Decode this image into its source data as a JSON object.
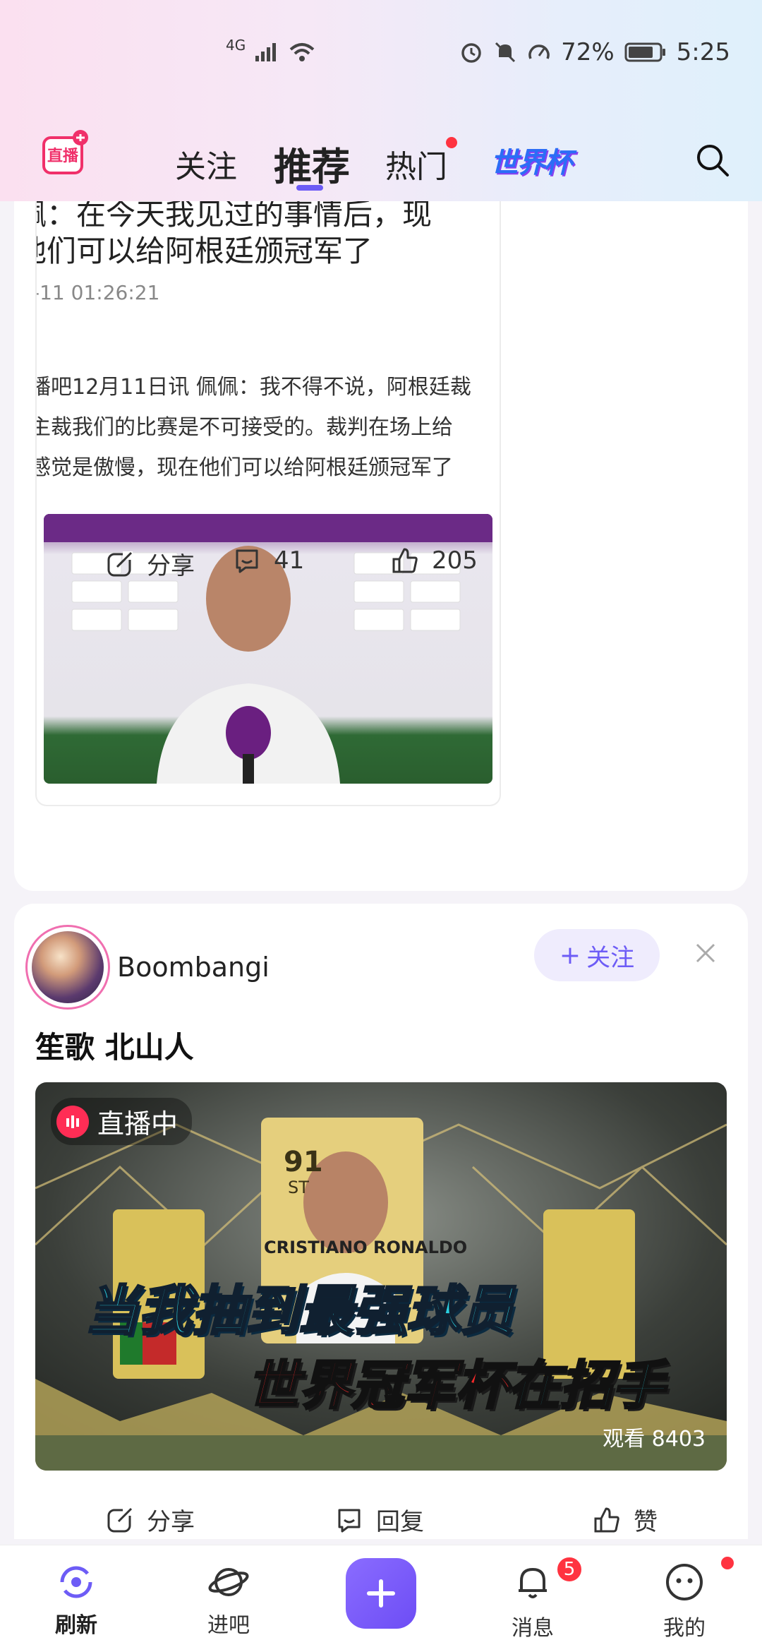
{
  "status_bar": {
    "network": "4G",
    "battery_text": "72%",
    "time": "5:25"
  },
  "nav": {
    "tabs": [
      {
        "label": "关注"
      },
      {
        "label": "推荐"
      },
      {
        "label": "热门"
      },
      {
        "label": "世界杯"
      }
    ],
    "logo_label": "直播"
  },
  "post1": {
    "embed": {
      "title_line1": "佩：在今天我见过的事情后，现",
      "title_line2": "他们可以给阿根廷颁冠军了",
      "time": "-11 01:26:21",
      "body_line1": "播吧12月11日讯 佩佩：我不得不说，阿根廷裁",
      "body_line2": "主裁我们的比赛是不可接受的。裁判在场上给",
      "body_line3": "感觉是傲慢，现在他们可以给阿根廷颁冠军了"
    },
    "actions": {
      "share_label": "分享",
      "comment_count": "41",
      "like_count": "205"
    }
  },
  "post2": {
    "username": "Boombangi",
    "follow_label": "关注",
    "title": "笙歌 北山人",
    "live_badge": "直播中",
    "caption_line1": "当我抽到最强球员",
    "caption_line2_red": "世界冠军杯",
    "caption_line2_cyan": "在招手",
    "card_rating": "91",
    "card_position": "ST",
    "card_name": "CRISTIANO RONALDO",
    "view_count": "观看 8403",
    "actions": {
      "share_label": "分享",
      "reply_label": "回复",
      "like_label": "赞"
    }
  },
  "bottom_nav": {
    "items": [
      {
        "label": "刷新"
      },
      {
        "label": "进吧"
      },
      {
        "label": "消息"
      },
      {
        "label": "我的"
      }
    ],
    "message_badge": "5"
  },
  "colors": {
    "accent": "#6d5cf6",
    "badge_red": "#ff3340"
  }
}
